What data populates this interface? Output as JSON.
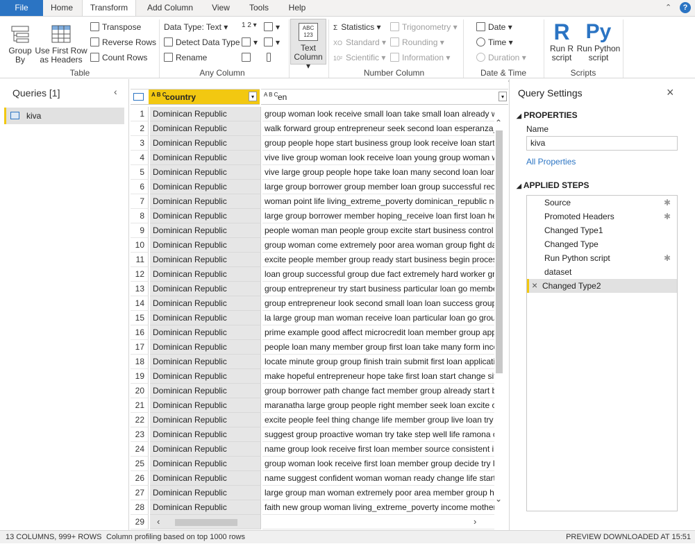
{
  "tabs": [
    "File",
    "Home",
    "Transform",
    "Add Column",
    "View",
    "Tools",
    "Help"
  ],
  "ribbon": {
    "table": {
      "group_by_1": "Group",
      "group_by_2": "By",
      "first_row_1": "Use First Row",
      "first_row_2": "as Headers",
      "transpose": "Transpose",
      "reverse_rows": "Reverse Rows",
      "count_rows": "Count Rows",
      "label": "Table"
    },
    "any_column": {
      "data_type": "Data Type: Text",
      "detect": "Detect Data Type",
      "rename": "Rename",
      "label": "Any Column",
      "sort_icon_text": "1 2"
    },
    "text_column": {
      "label_1": "Text",
      "label_2": "Column",
      "icon_text": "ABC 123"
    },
    "number_column": {
      "statistics": "Statistics",
      "standard": "Standard",
      "scientific": "Scientific",
      "trigonometry": "Trigonometry",
      "rounding": "Rounding",
      "information": "Information",
      "label": "Number Column",
      "standard_icon_text": "XO",
      "scientific_icon_text": "10²"
    },
    "datetime": {
      "date": "Date",
      "time": "Time",
      "duration": "Duration",
      "label": "Date & Time Column"
    },
    "scripts": {
      "r_1": "Run R",
      "r_2": "script",
      "py_1": "Run Python",
      "py_2": "script",
      "label": "Scripts",
      "r_icon": "R",
      "py_icon": "Py"
    }
  },
  "queries": {
    "title": "Queries [1]",
    "items": [
      "kiva"
    ]
  },
  "grid": {
    "col1": "country",
    "col2": "en",
    "type_icon": "A B C",
    "rows": [
      {
        "n": "1",
        "country": "Dominican Republic",
        "en": "group woman look receive small loan take small loan already would"
      },
      {
        "n": "2",
        "country": "Dominican Republic",
        "en": "walk forward group entrepreneur seek second loan esperanza_inter"
      },
      {
        "n": "3",
        "country": "Dominican Republic",
        "en": "group people hope start business group look receive loan start small"
      },
      {
        "n": "4",
        "country": "Dominican Republic",
        "en": "vive live group woman look receive loan young group woman want s"
      },
      {
        "n": "5",
        "country": "Dominican Republic",
        "en": "vive large group people hope take loan many second loan loan hope"
      },
      {
        "n": "6",
        "country": "Dominican Republic",
        "en": "large group borrower group member loan group successful receive s"
      },
      {
        "n": "7",
        "country": "Dominican Republic",
        "en": "woman point life living_extreme_poverty dominican_republic none"
      },
      {
        "n": "8",
        "country": "Dominican Republic",
        "en": "large group borrower member hoping_receive loan first loan help m"
      },
      {
        "n": "9",
        "country": "Dominican Republic",
        "en": "people woman man people group excite start business control futur"
      },
      {
        "n": "10",
        "country": "Dominican Republic",
        "en": "group woman come extremely poor area woman group fight day co"
      },
      {
        "n": "11",
        "country": "Dominican Republic",
        "en": "excite people member group ready start business begin process bett"
      },
      {
        "n": "12",
        "country": "Dominican Republic",
        "en": "loan group successful group due fact extremely hard worker great fr"
      },
      {
        "n": "13",
        "country": "Dominican Republic",
        "en": "group entrepreneur try start business particular loan go member gro"
      },
      {
        "n": "14",
        "country": "Dominican Republic",
        "en": "group entrepreneur look second small loan loan success group mem"
      },
      {
        "n": "15",
        "country": "Dominican Republic",
        "en": "la large group man woman receive loan particular loan go group me"
      },
      {
        "n": "16",
        "country": "Dominican Republic",
        "en": "prime example good affect microcredit loan member group apply lo"
      },
      {
        "n": "17",
        "country": "Dominican Republic",
        "en": "people loan many member group first loan take many form income"
      },
      {
        "n": "18",
        "country": "Dominican Republic",
        "en": "locate minute group group finish train submit first loan application u"
      },
      {
        "n": "19",
        "country": "Dominican Republic",
        "en": "make hopeful entrepreneur hope take first loan start change situatic"
      },
      {
        "n": "20",
        "country": "Dominican Republic",
        "en": "group borrower path change fact member group already start busine"
      },
      {
        "n": "21",
        "country": "Dominican Republic",
        "en": "maranatha large group people right member seek loan excite chance"
      },
      {
        "n": "22",
        "country": "Dominican Republic",
        "en": "excite people feel thing change life member group live loan try well"
      },
      {
        "n": "23",
        "country": "Dominican Republic",
        "en": "suggest group proactive woman try take step well life ramona choos"
      },
      {
        "n": "24",
        "country": "Dominican Republic",
        "en": "name group look receive first loan member source consistent incom"
      },
      {
        "n": "25",
        "country": "Dominican Republic",
        "en": "group woman look receive first loan member group decide try loan"
      },
      {
        "n": "26",
        "country": "Dominican Republic",
        "en": "name suggest confident woman woman ready change life start smal"
      },
      {
        "n": "27",
        "country": "Dominican Republic",
        "en": "large group man woman extremely poor area member group hoping"
      },
      {
        "n": "28",
        "country": "Dominican Republic",
        "en": "faith new group woman living_extreme_poverty income mother chil"
      },
      {
        "n": "29",
        "country": "",
        "en": ""
      }
    ]
  },
  "settings": {
    "title": "Query Settings",
    "properties": "PROPERTIES",
    "name_label": "Name",
    "name_value": "kiva",
    "all_properties": "All Properties",
    "applied_steps": "APPLIED STEPS",
    "steps": [
      "Source",
      "Promoted Headers",
      "Changed Type1",
      "Changed Type",
      "Run Python script",
      "dataset",
      "Changed Type2"
    ]
  },
  "status": {
    "columns": "13 COLUMNS, 999+ ROWS",
    "profiling": "Column profiling based on top 1000 rows",
    "preview": "PREVIEW DOWNLOADED AT 15:51"
  },
  "colors": {
    "accent": "#2b74c3",
    "header_yellow": "#f2c811"
  }
}
